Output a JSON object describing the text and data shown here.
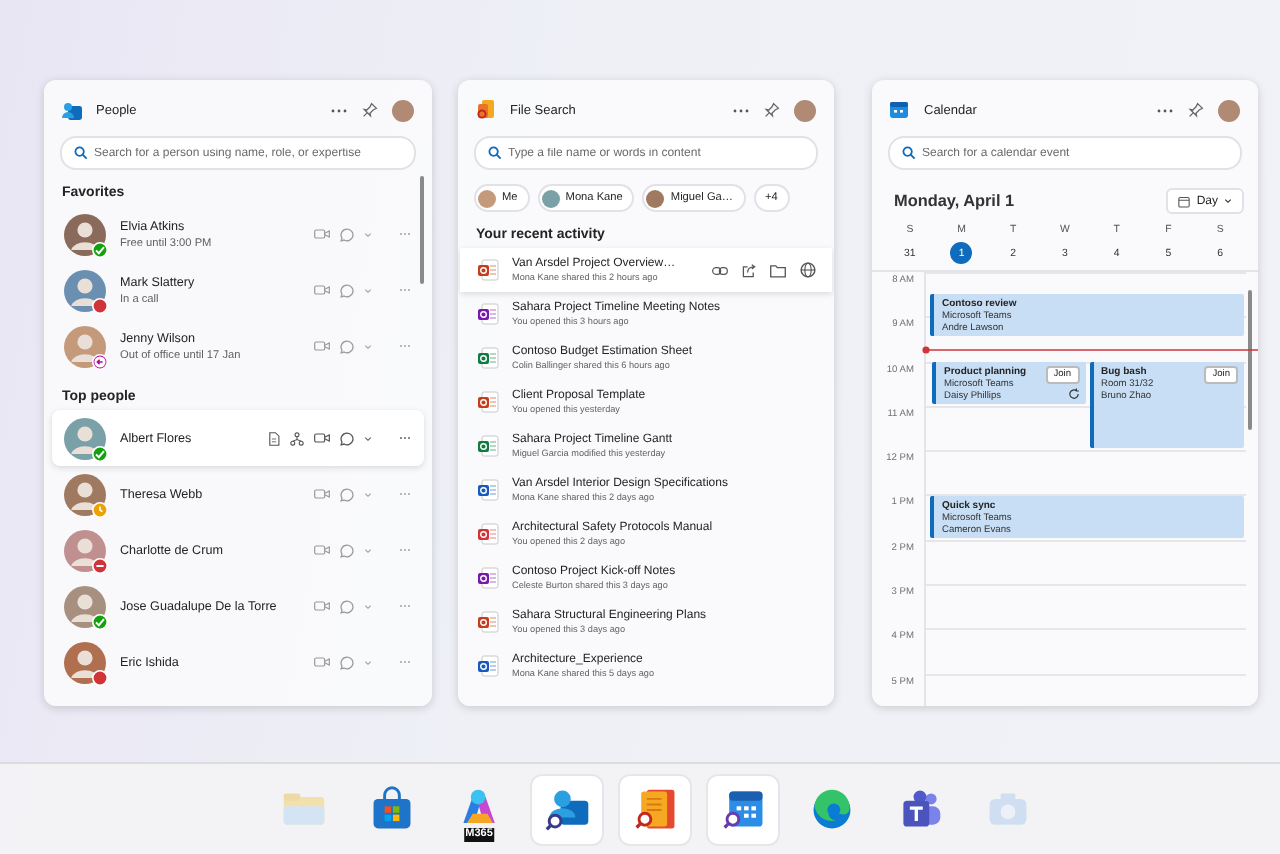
{
  "people": {
    "title": "People",
    "search": {
      "placeholder": "Search for a person using name, role, or expertise"
    },
    "favorites": {
      "heading": "Favorites",
      "items": [
        {
          "name": "Elvia Atkins",
          "note": "Free until 3:00 PM",
          "kind": "available",
          "highlighted": false
        },
        {
          "name": "Mark Slattery",
          "note": "In a call",
          "kind": "busy",
          "highlighted": false
        },
        {
          "name": "Jenny Wilson",
          "note": "Out of office until 17 Jan",
          "kind": "ooo",
          "highlighted": false
        }
      ]
    },
    "top_people": {
      "heading": "Top people",
      "items": [
        {
          "name": "Albert Flores",
          "kind": "available",
          "highlighted": true
        },
        {
          "name": "Theresa Webb",
          "kind": "away",
          "highlighted": false
        },
        {
          "name": "Charlotte de Crum",
          "kind": "dnd",
          "highlighted": false
        },
        {
          "name": "Jose Guadalupe De la Torre",
          "kind": "available",
          "highlighted": false
        },
        {
          "name": "Eric Ishida",
          "kind": "busy",
          "highlighted": false
        }
      ]
    }
  },
  "file_search": {
    "title": "File Search",
    "search": {
      "placeholder": "Type a file name or words in content"
    },
    "filters": [
      {
        "label": "Me",
        "kind": "person"
      },
      {
        "label": "Mona Kane",
        "kind": "person"
      },
      {
        "label": "Miguel Ga…",
        "kind": "person"
      },
      {
        "label": "+4",
        "kind": "more"
      }
    ],
    "heading": "Your recent activity",
    "files": [
      {
        "name": "Van Arsdel Project Overview…",
        "detail": "Mona Kane shared this 2 hours ago",
        "kind": "powerpoint",
        "highlighted": true
      },
      {
        "name": "Sahara Project Timeline Meeting Notes",
        "detail": "You opened this 3 hours ago",
        "kind": "onenote",
        "highlighted": false
      },
      {
        "name": "Contoso Budget Estimation Sheet",
        "detail": "Colin Ballinger shared this 6 hours ago",
        "kind": "excel",
        "highlighted": false
      },
      {
        "name": "Client Proposal Template",
        "detail": "You opened this yesterday",
        "kind": "powerpoint",
        "highlighted": false
      },
      {
        "name": "Sahara Project Timeline Gantt",
        "detail": "Miguel Garcia modified this yesterday",
        "kind": "excel",
        "highlighted": false
      },
      {
        "name": "Van Arsdel Interior Design Specifications",
        "detail": "Mona Kane shared this 2 days ago",
        "kind": "word",
        "highlighted": false
      },
      {
        "name": "Architectural Safety Protocols Manual",
        "detail": "You opened this 2 days ago",
        "kind": "pdf",
        "highlighted": false
      },
      {
        "name": "Contoso Project Kick-off Notes",
        "detail": "Celeste Burton shared this 3 days ago",
        "kind": "onenote",
        "highlighted": false
      },
      {
        "name": "Sahara Structural Engineering Plans",
        "detail": "You opened this 3 days ago",
        "kind": "powerpoint",
        "highlighted": false
      },
      {
        "name": "Architecture_Experience",
        "detail": "Mona Kane shared this 5 days ago",
        "kind": "word",
        "highlighted": false
      }
    ]
  },
  "calendar": {
    "title": "Calendar",
    "search": {
      "placeholder": "Search for a calendar event"
    },
    "date": "Monday, April 1",
    "view": "Day",
    "days": [
      {
        "letter": "S",
        "date": "31",
        "selected": false
      },
      {
        "letter": "M",
        "date": "1",
        "selected": true
      },
      {
        "letter": "T",
        "date": "2",
        "selected": false
      },
      {
        "letter": "W",
        "date": "3",
        "selected": false
      },
      {
        "letter": "T",
        "date": "4",
        "selected": false
      },
      {
        "letter": "F",
        "date": "5",
        "selected": false
      },
      {
        "letter": "S",
        "date": "6",
        "selected": false
      }
    ],
    "hours": [
      {
        "label": "8 AM",
        "now": false,
        "events": [
          {
            "title": "Contoso review",
            "lines": [
              "Microsoft Teams",
              "Andre Lawson"
            ],
            "kind": "wide",
            "half_past": true,
            "long": false,
            "recurring": false
          }
        ]
      },
      {
        "label": "9 AM",
        "now": true
      },
      {
        "label": "10 AM",
        "now": false,
        "events": [
          {
            "title": "Product planning",
            "lines": [
              "Microsoft Teams",
              "Daisy Phillips"
            ],
            "kind": "left",
            "half_past": false,
            "long": false,
            "join": "Join",
            "recurring": true
          },
          {
            "title": "Bug bash",
            "lines": [
              "Room 31/32",
              "Bruno Zhao"
            ],
            "kind": "right",
            "half_past": false,
            "long": true,
            "join": "Join",
            "recurring": false
          }
        ]
      },
      {
        "label": "11 AM",
        "now": false
      },
      {
        "label": "12 PM",
        "now": false
      },
      {
        "label": "1 PM",
        "now": false,
        "events": [
          {
            "title": "Quick sync",
            "lines": [
              "Microsoft Teams",
              "Cameron Evans"
            ],
            "kind": "wide",
            "half_past": false,
            "long": false,
            "recurring": false
          }
        ]
      },
      {
        "label": "2 PM",
        "now": false
      },
      {
        "label": "3 PM",
        "now": false
      },
      {
        "label": "4 PM",
        "now": false
      },
      {
        "label": "5 PM",
        "now": false
      }
    ]
  },
  "taskbar": {
    "apps": [
      {
        "kind": "folder",
        "selected": false,
        "faded": true
      },
      {
        "kind": "store",
        "selected": false,
        "faded": false
      },
      {
        "kind": "m365",
        "badge": "M365",
        "selected": false,
        "faded": false
      },
      {
        "kind": "people",
        "selected": true,
        "faded": false
      },
      {
        "kind": "file-search",
        "selected": true,
        "faded": false
      },
      {
        "kind": "calendar",
        "selected": true,
        "faded": false
      },
      {
        "kind": "browser",
        "selected": false,
        "faded": false
      },
      {
        "kind": "teams",
        "selected": false,
        "faded": false
      },
      {
        "kind": "camera",
        "selected": false,
        "faded": true
      }
    ]
  }
}
